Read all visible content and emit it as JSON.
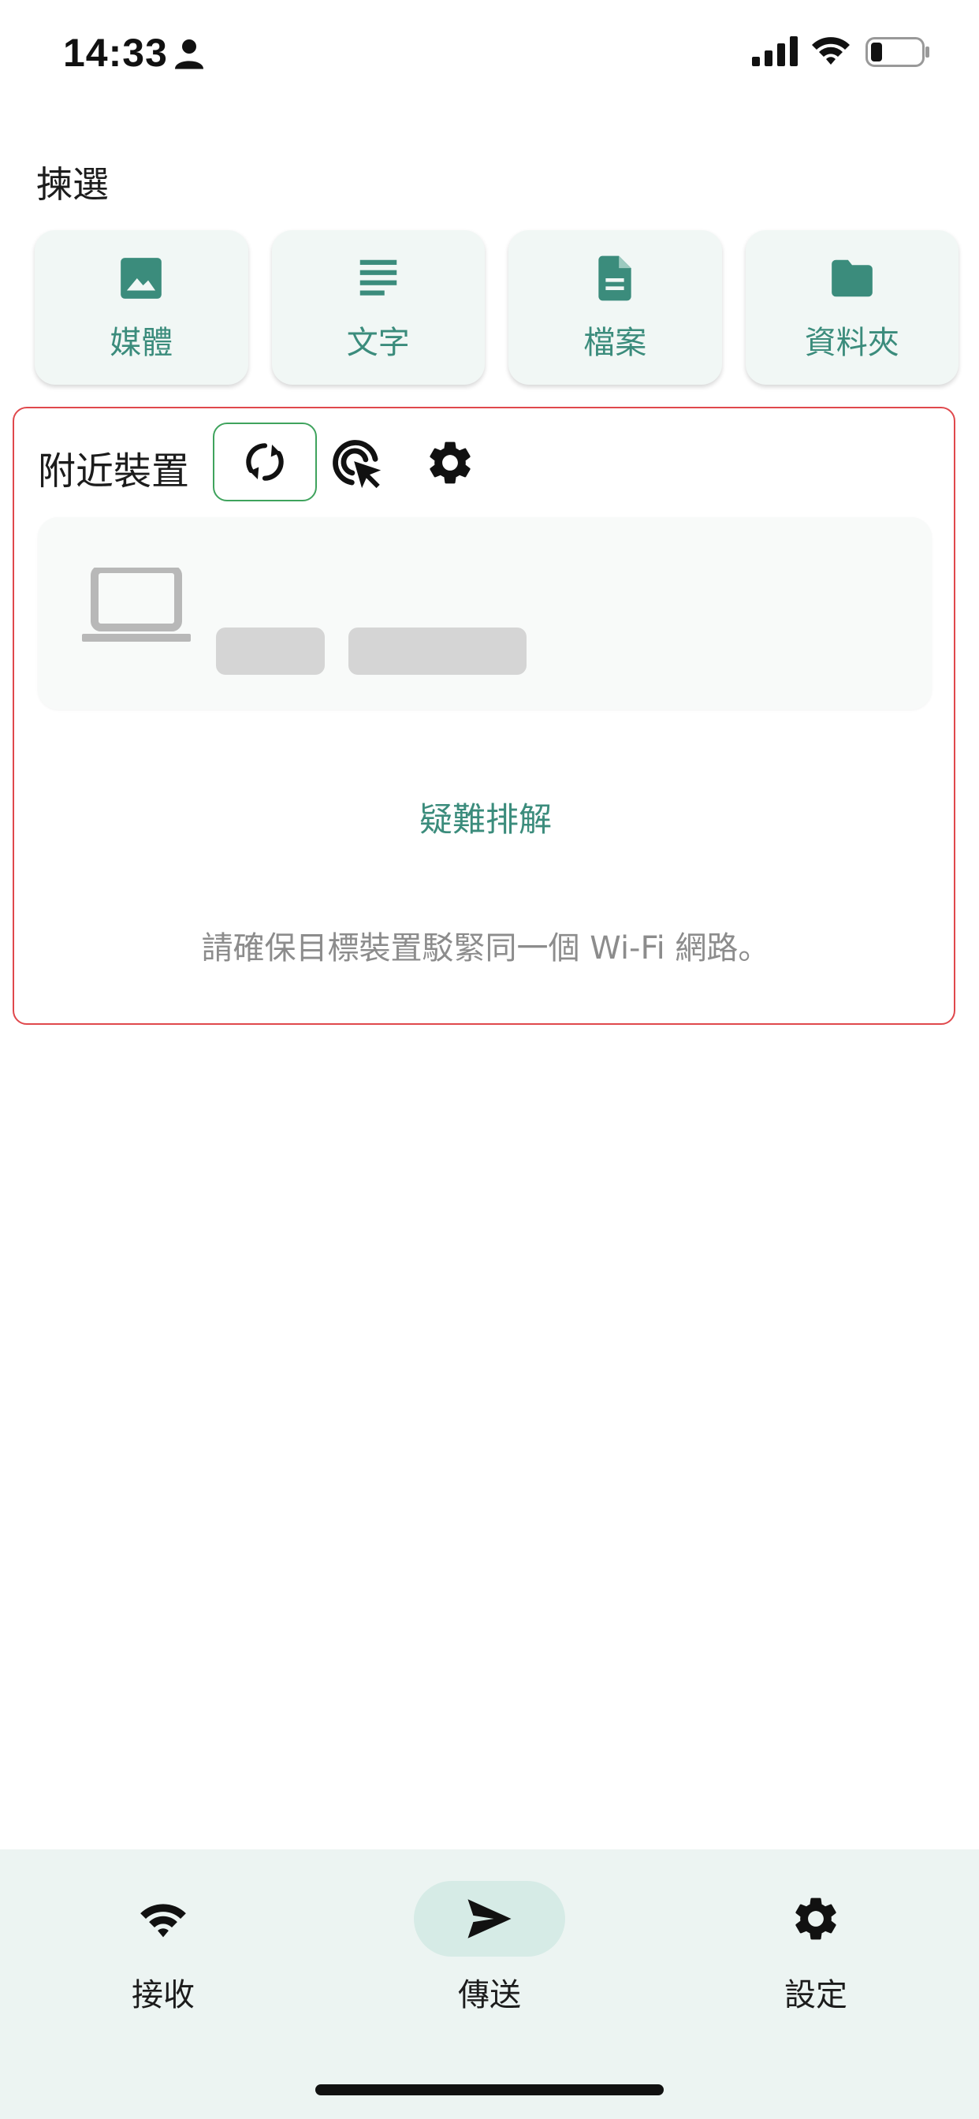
{
  "status_bar": {
    "time": "14:33"
  },
  "pick_section": {
    "title": "揀選",
    "items": [
      {
        "label": "媒體",
        "icon": "image-icon"
      },
      {
        "label": "文字",
        "icon": "text-lines-icon"
      },
      {
        "label": "檔案",
        "icon": "file-icon"
      },
      {
        "label": "資料夾",
        "icon": "folder-icon"
      }
    ]
  },
  "nearby": {
    "title": "附近裝置",
    "troubleshoot": "疑難排解",
    "hint": "請確保目標裝置駁緊同一個 Wi-Fi 網路。"
  },
  "bottom_nav": {
    "items": [
      {
        "label": "接收",
        "icon": "wifi-icon",
        "active": false
      },
      {
        "label": "傳送",
        "icon": "send-icon",
        "active": true
      },
      {
        "label": "設定",
        "icon": "gear-icon",
        "active": false
      }
    ]
  },
  "colors": {
    "accent": "#3b8c7c",
    "card_bg": "#f1f7f5",
    "nav_bg": "#ecf4f2",
    "nav_active": "#d6ebe6",
    "panel_border": "#e0484c"
  }
}
